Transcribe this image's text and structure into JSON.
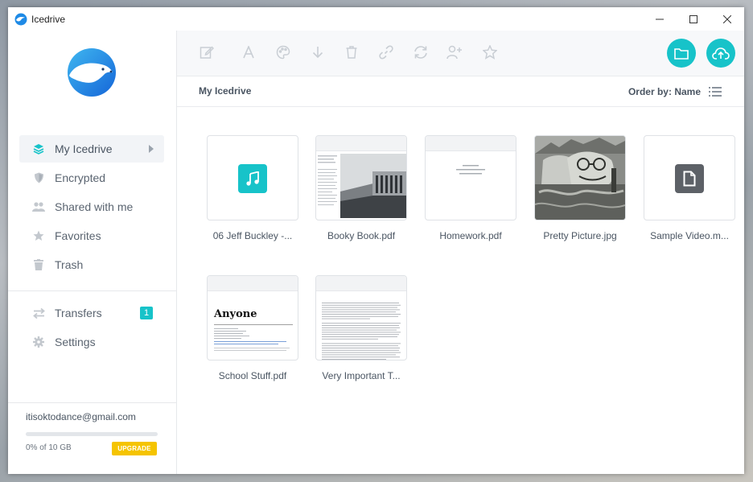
{
  "window": {
    "title": "Icedrive"
  },
  "sidebar": {
    "items": [
      {
        "label": "My Icedrive",
        "icon": "layers-icon",
        "active": true
      },
      {
        "label": "Encrypted",
        "icon": "shield-icon"
      },
      {
        "label": "Shared with me",
        "icon": "users-icon"
      },
      {
        "label": "Favorites",
        "icon": "star-icon"
      },
      {
        "label": "Trash",
        "icon": "trash-icon"
      }
    ],
    "secondary": [
      {
        "label": "Transfers",
        "icon": "transfer-icon",
        "badge": "1"
      },
      {
        "label": "Settings",
        "icon": "gear-icon"
      }
    ],
    "account": {
      "email": "itisoktodance@gmail.com",
      "quota_text": "0% of 10 GB",
      "quota_percent": 0,
      "upgrade_label": "UPGRADE"
    }
  },
  "toolbar": {
    "tools": [
      "edit-icon",
      "rename-icon",
      "palette-icon",
      "download-icon",
      "delete-icon",
      "link-icon",
      "sync-icon",
      "add-user-icon",
      "favorite-icon"
    ],
    "new_folder_icon": "folder-icon",
    "upload_icon": "cloud-upload-icon"
  },
  "pathbar": {
    "breadcrumb": "My Icedrive",
    "order_by": "Order by: Name"
  },
  "files": [
    {
      "name": "06 Jeff Buckley -...",
      "type": "audio"
    },
    {
      "name": "Booky Book.pdf",
      "type": "pdf-photo"
    },
    {
      "name": "Homework.pdf",
      "type": "pdf-text"
    },
    {
      "name": "Pretty Picture.jpg",
      "type": "image"
    },
    {
      "name": "Sample Video.m...",
      "type": "video"
    },
    {
      "name": "School Stuff.pdf",
      "type": "pdf-resume",
      "thumb_heading": "Anyone"
    },
    {
      "name": "Very Important T...",
      "type": "pdf-dense"
    }
  ],
  "colors": {
    "accent": "#17c3c9",
    "upgrade": "#f5c400",
    "text": "#4a5562"
  }
}
